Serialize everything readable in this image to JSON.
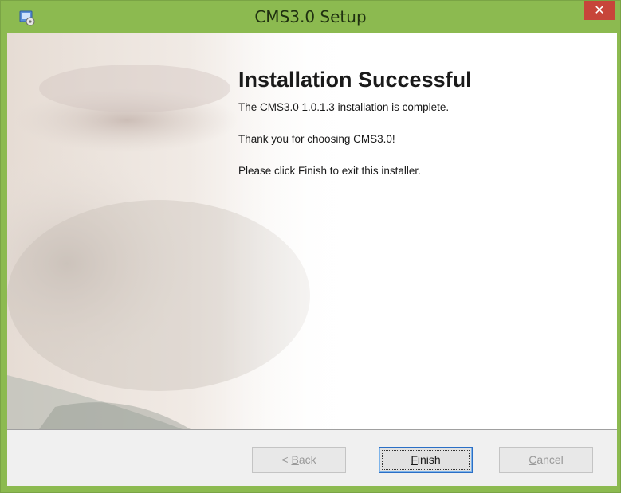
{
  "window": {
    "title": "CMS3.0 Setup",
    "close_glyph": "✕",
    "icon": "installer-icon"
  },
  "content": {
    "heading": "Installation Successful",
    "line1": "The CMS3.0 1.0.1.3 installation is complete.",
    "line2": "Thank you for choosing CMS3.0!",
    "line3": "Please click Finish to exit this installer."
  },
  "buttons": {
    "back_prefix": "< ",
    "back_mnemonic": "B",
    "back_rest": "ack",
    "finish_mnemonic": "F",
    "finish_rest": "inish",
    "cancel_mnemonic": "C",
    "cancel_rest": "ancel"
  },
  "colors": {
    "titlebar": "#8cba50",
    "close": "#c7453a",
    "footer": "#f0f0f0"
  }
}
